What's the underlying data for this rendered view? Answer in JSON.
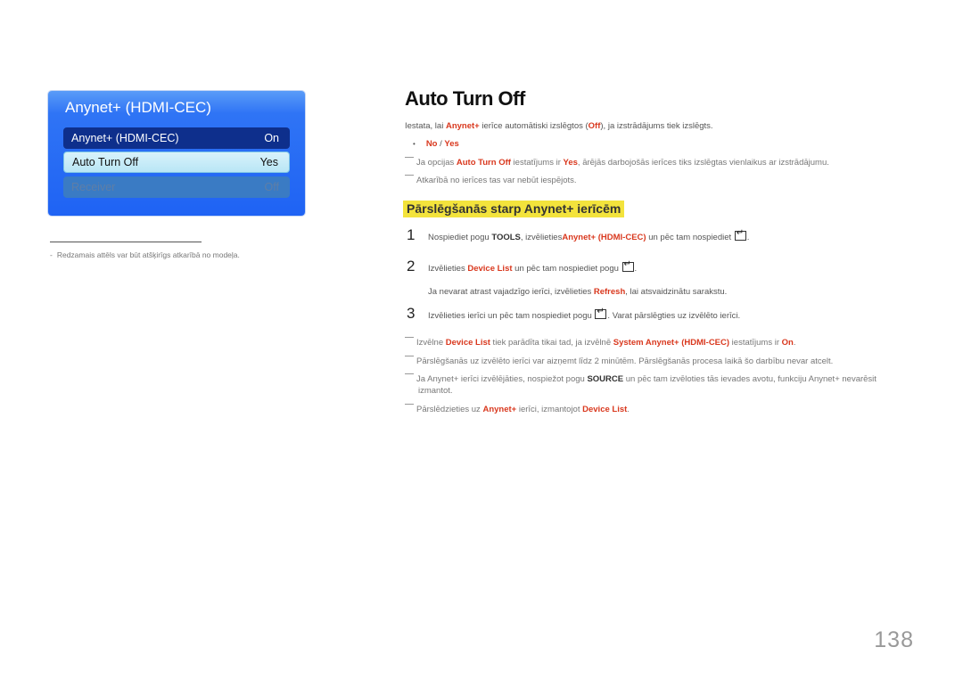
{
  "osd_menu": {
    "title": "Anynet+ (HDMI-CEC)",
    "rows": [
      {
        "label": "Anynet+ (HDMI-CEC)",
        "value": "On",
        "state": "normal"
      },
      {
        "label": "Auto Turn Off",
        "value": "Yes",
        "state": "selected"
      },
      {
        "label": "Receiver",
        "value": "Off",
        "state": "disabled"
      }
    ]
  },
  "footnote": {
    "dash": "-",
    "text": "Redzamais attēls var būt atšķirīgs atkarībā no modeļa."
  },
  "section1": {
    "title": "Auto Turn Off",
    "intro": {
      "t1": "Iestata, lai ",
      "k1": "Anynet+",
      "t2": " ierīce automātiski izslēgtos (",
      "k2": "Off",
      "t3": "), ja izstrādājums tiek izslēgts."
    },
    "bullet": {
      "symbol": "•",
      "opt1": "No",
      "sep": " / ",
      "opt2": "Yes"
    },
    "notes": [
      {
        "t1": "Ja opcijas ",
        "k1": "Auto Turn Off",
        "t2": " iestatījums ir ",
        "k2": "Yes",
        "t3": ", ārējās darbojošās ierīces tiks izslēgtas vienlaikus ar izstrādājumu."
      },
      {
        "t1": "Atkarībā no ierīces tas var nebūt iespējots."
      }
    ]
  },
  "section2": {
    "title": "Pārslēgšanās starp Anynet+ ierīcēm",
    "steps": [
      {
        "num": "1",
        "t1": "Nospiediet pogu ",
        "b1": "TOOLS",
        "t2": ", izvēlieties",
        "k1": "Anynet+ (HDMI-CEC)",
        "t3": " un pēc tam nospiediet ",
        "t4": "."
      },
      {
        "num": "2",
        "t1": "Izvēlieties ",
        "k1": "Device List",
        "t2": " un pēc tam nospiediet pogu ",
        "t3": ".",
        "sub": {
          "t1": "Ja nevarat atrast vajadzīgo ierīci, izvēlieties ",
          "k1": "Refresh",
          "t2": ", lai atsvaidzinātu sarakstu."
        }
      },
      {
        "num": "3",
        "t1": "Izvēlieties ierīci un pēc tam nospiediet pogu ",
        "t2": ". Varat pārslēgties uz izvēlēto ierīci."
      }
    ],
    "notes": [
      {
        "t1": "Izvēlne ",
        "k1": "Device List",
        "t2": " tiek parādīta tikai tad, ja izvēlnē ",
        "k2": "System Anynet+ (HDMI-CEC)",
        "t3": " iestatījums ir ",
        "k3": "On",
        "t4": "."
      },
      {
        "t1": "Pārslēgšanās uz izvēlēto ierīci var aizņemt līdz 2 minūtēm. Pārslēgšanās procesa laikā šo darbību nevar atcelt."
      },
      {
        "t1": "Ja Anynet+ ierīci izvēlējāties, nospiežot pogu ",
        "b1": "SOURCE",
        "t2": " un pēc tam izvēloties tās ievades avotu, funkciju Anynet+ nevarēsit",
        "t3": "izmantot."
      },
      {
        "t1": "Pārslēdzieties uz ",
        "k1": "Anynet+",
        "t2": " ierīci, izmantojot ",
        "k2": "Device List",
        "t3": "."
      }
    ]
  },
  "page_number": "138",
  "icons": {
    "enter": "enter-key-icon"
  }
}
